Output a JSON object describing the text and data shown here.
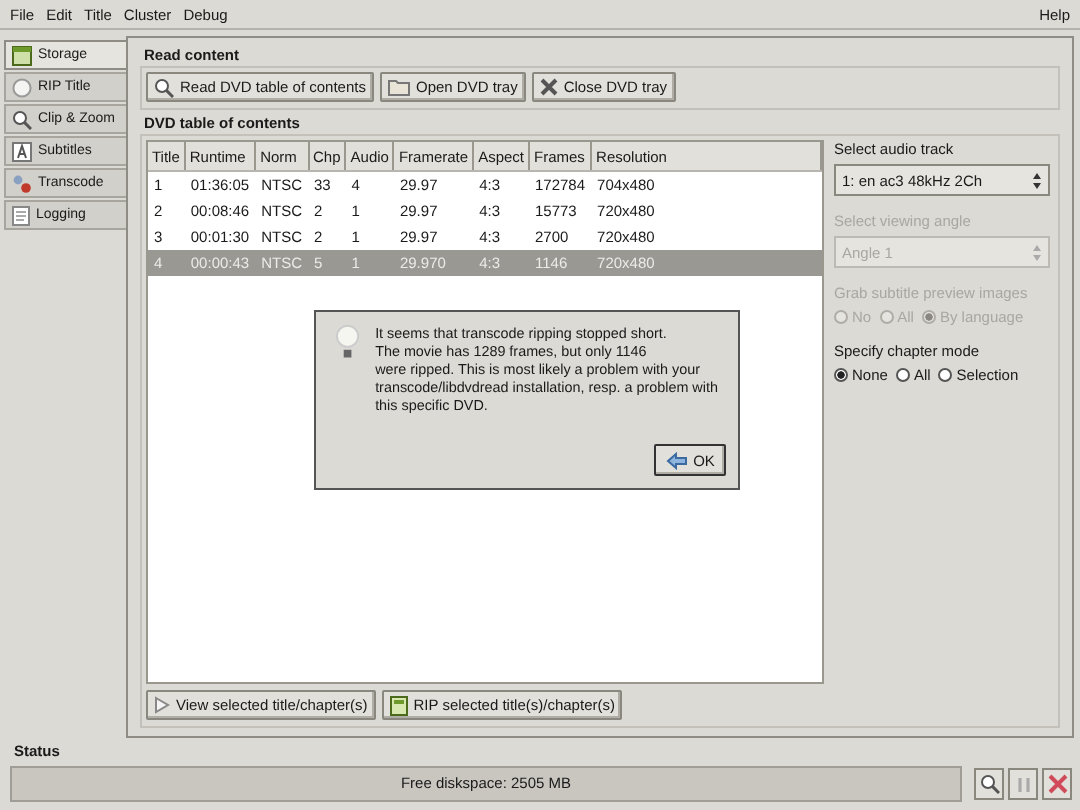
{
  "menu": [
    {
      "label": "File"
    },
    {
      "label": "Edit"
    },
    {
      "label": "Title"
    },
    {
      "label": "Cluster"
    },
    {
      "label": "Debug"
    }
  ],
  "help_menu": "Help",
  "sidebar": {
    "items": [
      {
        "label": "Storage",
        "selected": true
      },
      {
        "label": "RIP Title",
        "selected": false
      },
      {
        "label": "Clip & Zoom",
        "selected": false
      },
      {
        "label": "Subtitles",
        "selected": false
      },
      {
        "label": "Transcode",
        "selected": false
      },
      {
        "label": "Logging",
        "selected": false
      }
    ]
  },
  "read_content": {
    "title": "Read content",
    "buttons": [
      "Read DVD table of contents",
      "Open DVD tray",
      "Close DVD tray"
    ]
  },
  "toc": {
    "title": "DVD table of contents",
    "columns": [
      "Title",
      "Runtime",
      "Norm",
      "Chp",
      "Audio",
      "Framerate",
      "Aspect",
      "Frames",
      "Resolution"
    ],
    "rows": [
      {
        "cells": [
          "1",
          "01:36:05",
          "NTSC",
          "33",
          "4",
          "29.97",
          "4:3",
          "172784",
          "704x480"
        ],
        "selected": false
      },
      {
        "cells": [
          "2",
          "00:08:46",
          "NTSC",
          "2",
          "1",
          "29.97",
          "4:3",
          "15773",
          "720x480"
        ],
        "selected": false
      },
      {
        "cells": [
          "3",
          "00:01:30",
          "NTSC",
          "2",
          "1",
          "29.97",
          "4:3",
          "2700",
          "720x480"
        ],
        "selected": false
      },
      {
        "cells": [
          "4",
          "00:00:43",
          "NTSC",
          "5",
          "1",
          "29.970",
          "4:3",
          "1146",
          "720x480"
        ],
        "selected": true
      }
    ],
    "buttons": [
      "View selected title/chapter(s)",
      "RIP selected title(s)/chapter(s)"
    ]
  },
  "audio_track": {
    "label": "Select audio track",
    "value": "1: en ac3 48kHz 2Ch",
    "disabled": false
  },
  "viewing_angle": {
    "label": "Select viewing angle",
    "value": "Angle 1",
    "disabled": true
  },
  "subtitle_preview": {
    "label": "Grab subtitle preview images",
    "disabled": true,
    "options": [
      {
        "label": "No",
        "selected": false
      },
      {
        "label": "All",
        "selected": false
      },
      {
        "label": "By language",
        "selected": true
      }
    ]
  },
  "chapter_mode": {
    "label": "Specify chapter mode",
    "disabled": false,
    "options": [
      {
        "label": "None",
        "selected": true
      },
      {
        "label": "All",
        "selected": false
      },
      {
        "label": "Selection",
        "selected": false
      }
    ]
  },
  "status": {
    "title": "Status",
    "text": "Free diskspace: 2505 MB"
  },
  "dialog": {
    "message": "It seems that transcode ripping stopped short.\nThe movie has 1289 frames, but only 1146\nwere ripped. This is most likely a problem with your transcode/libdvdread installation, resp. a problem with this specific DVD.",
    "button": "OK"
  }
}
